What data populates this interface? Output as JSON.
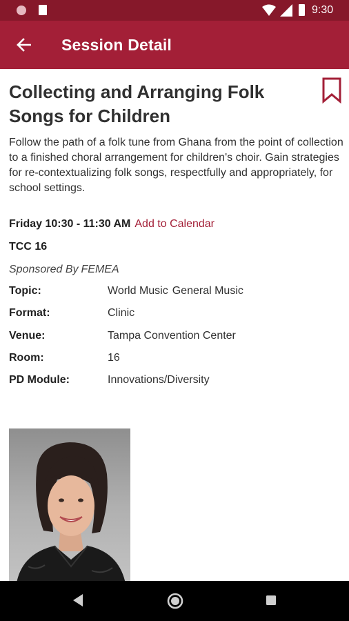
{
  "status_bar": {
    "time": "9:30",
    "icons": [
      "notification-dot-icon",
      "sd-card-icon",
      "wifi-icon",
      "cell-signal-icon",
      "battery-icon"
    ]
  },
  "app_bar": {
    "title": "Session Detail",
    "back_icon": "arrow-left-icon",
    "background": "#a31f37"
  },
  "session": {
    "title": "Collecting and Arranging Folk Songs for Children",
    "bookmark_icon": "bookmark-outline-icon",
    "description": "Follow the path of a folk tune from Ghana from the point of collection to a finished choral arrangement for children's choir. Gain strategies for re-contextualizing folk songs, respectfully and appropriately, for school settings.",
    "time": "Friday 10:30 -  11:30 AM",
    "add_to_calendar": "Add to Calendar",
    "location_code": "TCC 16",
    "sponsored_by_label": "Sponsored By",
    "sponsor": "FEMEA",
    "details": {
      "topic_label": "Topic:",
      "topic_values": [
        "World Music",
        "General Music"
      ],
      "format_label": "Format:",
      "format_value": "Clinic",
      "venue_label": "Venue:",
      "venue_value": "Tampa Convention Center",
      "room_label": "Room:",
      "room_value": "16",
      "pd_module_label": "PD Module:",
      "pd_module_value": "Innovations/Diversity"
    }
  },
  "speaker": {
    "photo": "speaker-portrait"
  },
  "nav_bar": {
    "icons": [
      "back-triangle-icon",
      "home-circle-icon",
      "recents-square-icon"
    ]
  },
  "colors": {
    "accent": "#a31f37",
    "status_bar": "#86182a",
    "link": "#a31f37"
  }
}
